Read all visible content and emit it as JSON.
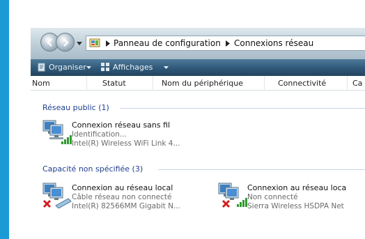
{
  "address_bar": {
    "segments": [
      "Panneau de configuration",
      "Connexions réseau"
    ]
  },
  "toolbar": {
    "organize_label": "Organiser",
    "views_label": "Affichages"
  },
  "columns": [
    "Nom",
    "Statut",
    "Nom du périphérique",
    "Connectivité",
    "Ca"
  ],
  "groups": [
    {
      "title": "Réseau public (1)",
      "items": [
        {
          "name": "Connexion réseau sans fil",
          "status": "Identification...",
          "device": "Intel(R) Wireless WiFi Link 4...",
          "icon": "wireless-network-icon"
        }
      ]
    },
    {
      "title": "Capacité non spécifiée (3)",
      "items": [
        {
          "name": "Connexion au réseau local",
          "status": "Câble réseau non connecté",
          "device": "Intel(R) 82566MM Gigabit N...",
          "icon": "ethernet-disconnected-icon"
        },
        {
          "name": "Connexion au réseau loca",
          "status": "Non connecté",
          "device": "Sierra Wireless HSDPA Net",
          "icon": "mobile-broadband-disconnected-icon"
        }
      ]
    }
  ],
  "colors": {
    "accent_bar": "#1c9ad6",
    "toolbar": "#2f5878",
    "group_title": "#1e3f8f",
    "error_x": "#d21f1f",
    "signal": "#2f9a2f"
  }
}
